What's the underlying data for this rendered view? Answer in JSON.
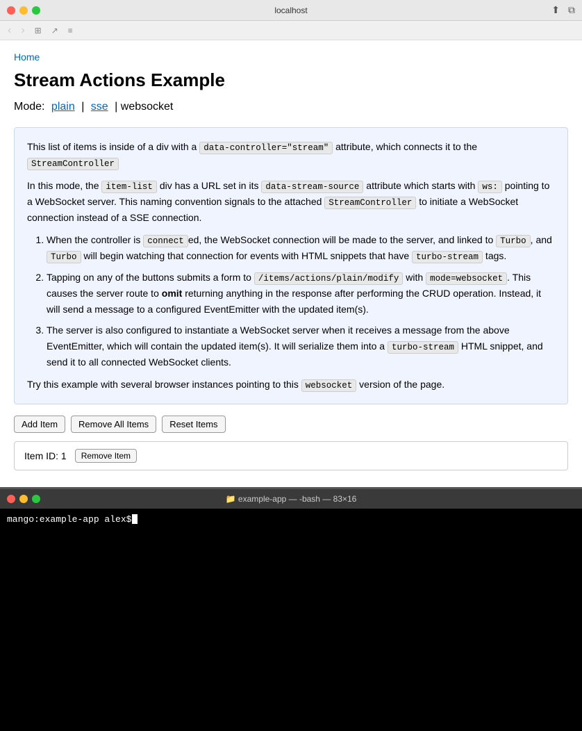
{
  "browser": {
    "url": "localhost",
    "nav_back_disabled": true,
    "nav_forward_disabled": true
  },
  "breadcrumb": {
    "home_label": "Home",
    "home_href": "#"
  },
  "page": {
    "title": "Stream Actions Example",
    "mode_label": "Mode:",
    "mode_plain_label": "plain",
    "mode_plain_href": "#plain",
    "mode_separator": "|",
    "mode_sse_label": "sse",
    "mode_sse_href": "#sse",
    "mode_current": "| websocket"
  },
  "info_box": {
    "para1_prefix": "This list of items is inside of a div with a",
    "para1_code1": "data-controller=\"stream\"",
    "para1_suffix": "attribute, which connects it to the",
    "para1_code2": "StreamController",
    "para2_prefix": "In this mode, the",
    "para2_code1": "item-list",
    "para2_middle": "div has a URL set in its",
    "para2_code2": "data-stream-source",
    "para2_suffix1": "attribute which starts with",
    "para2_code3": "ws:",
    "para2_suffix2": "pointing to a WebSocket server. This naming convention signals to the attached",
    "para2_code4": "StreamController",
    "para2_suffix3": "to initiate a WebSocket connection instead of a SSE connection.",
    "list_items": [
      {
        "text_before": "When the controller is",
        "code1": "connect",
        "text_middle": "ed, the WebSocket connection will be made to the server, and linked to",
        "code2": "Turbo",
        "text_after": ", and",
        "line2_code1": "Turbo",
        "line2_text": "will begin watching that connection for events with HTML snippets that have",
        "line2_code2": "turbo-stream",
        "line2_end": "tags."
      },
      {
        "text_before": "Tapping on any of the buttons submits a form to",
        "code1": "/items/actions/plain/modify",
        "text_middle": "with",
        "code2": "mode=websocket",
        "text_after": ". This causes the server route to",
        "bold": "omit",
        "text_after2": "returning anything in the response after performing the CRUD operation. Instead, it will send a message to a configured EventEmitter with the updated item(s)."
      },
      {
        "text_before": "The server is also configured to instantiate a WebSocket server when it receives a message from the above EventEmitter, which will contain the updated item(s). It will serialize them into a",
        "code1": "turbo-stream",
        "text_after": "HTML snippet, and send it to all connected WebSocket clients."
      }
    ],
    "footer_prefix": "Try this example with several browser instances pointing to this",
    "footer_code": "websocket",
    "footer_suffix": "version of the page."
  },
  "actions": {
    "add_item_label": "Add Item",
    "remove_all_label": "Remove All Items",
    "reset_items_label": "Reset Items"
  },
  "items": [
    {
      "id": 1,
      "label": "Item ID: 1",
      "remove_label": "Remove Item"
    }
  ],
  "terminal": {
    "title": "example-app — -bash — 83×16",
    "folder_icon": "📁",
    "prompt": "mango:example-app alex$"
  }
}
